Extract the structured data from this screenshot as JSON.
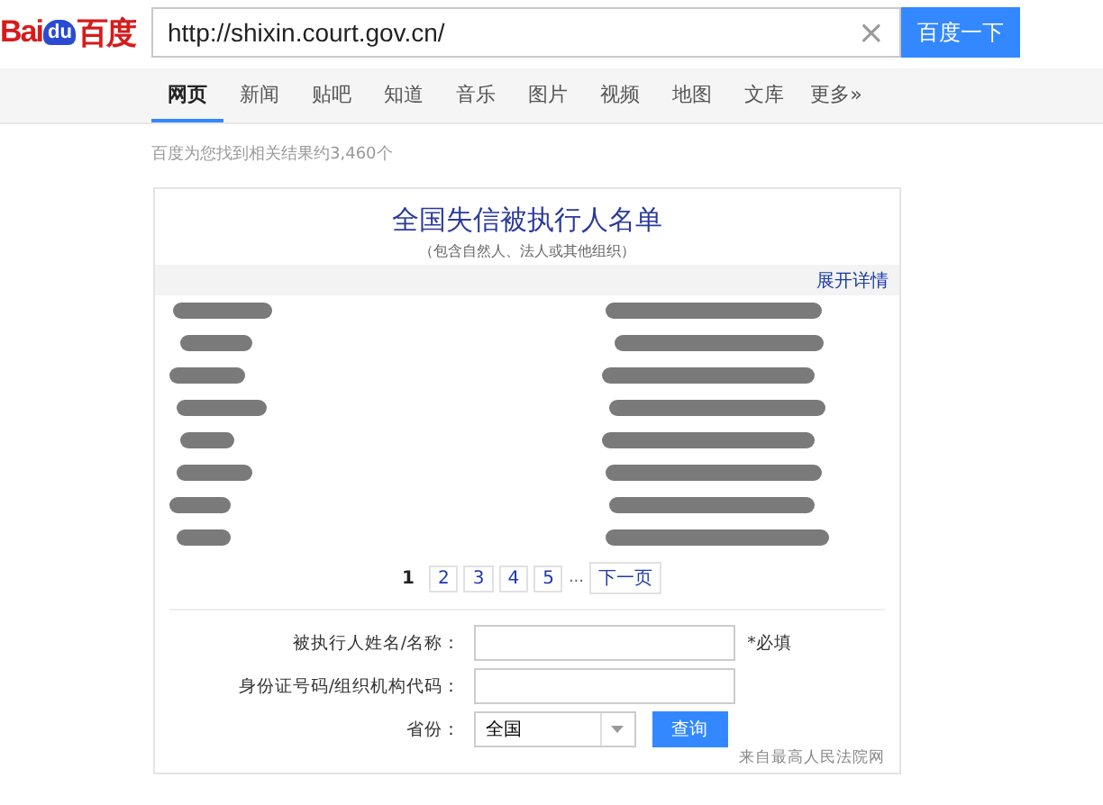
{
  "logo": {
    "latin_a": "Bai",
    "badge": "du",
    "chinese": "百度"
  },
  "search": {
    "value": "http://shixin.court.gov.cn/",
    "clear": "×",
    "button": "百度一下"
  },
  "tabs": [
    {
      "label": "网页",
      "selected": true
    },
    {
      "label": "新闻",
      "selected": false
    },
    {
      "label": "贴吧",
      "selected": false
    },
    {
      "label": "知道",
      "selected": false
    },
    {
      "label": "音乐",
      "selected": false
    },
    {
      "label": "图片",
      "selected": false
    },
    {
      "label": "视频",
      "selected": false
    },
    {
      "label": "地图",
      "selected": false
    },
    {
      "label": "文库",
      "selected": false
    },
    {
      "label": "更多»",
      "selected": false
    }
  ],
  "result_count": "百度为您找到相关结果约3,460个",
  "card": {
    "title": "全国失信被执行人名单",
    "subtitle": "（包含自然人、法人或其他组织）",
    "expand_link": "展开详情",
    "pagination": [
      {
        "label": "1",
        "selected": true
      },
      {
        "label": "2",
        "selected": false
      },
      {
        "label": "3",
        "selected": false
      },
      {
        "label": "4",
        "selected": false
      },
      {
        "label": "5",
        "selected": false
      }
    ],
    "ellipsis": "...",
    "next_page": "下一页",
    "form": {
      "name_label": "被执行人姓名/名称：",
      "required": "*必填",
      "id_label": "身份证号码/组织机构代码：",
      "province_label": "省份：",
      "province_value": "全国",
      "submit": "查询"
    },
    "source": "来自最高人民法院网"
  }
}
